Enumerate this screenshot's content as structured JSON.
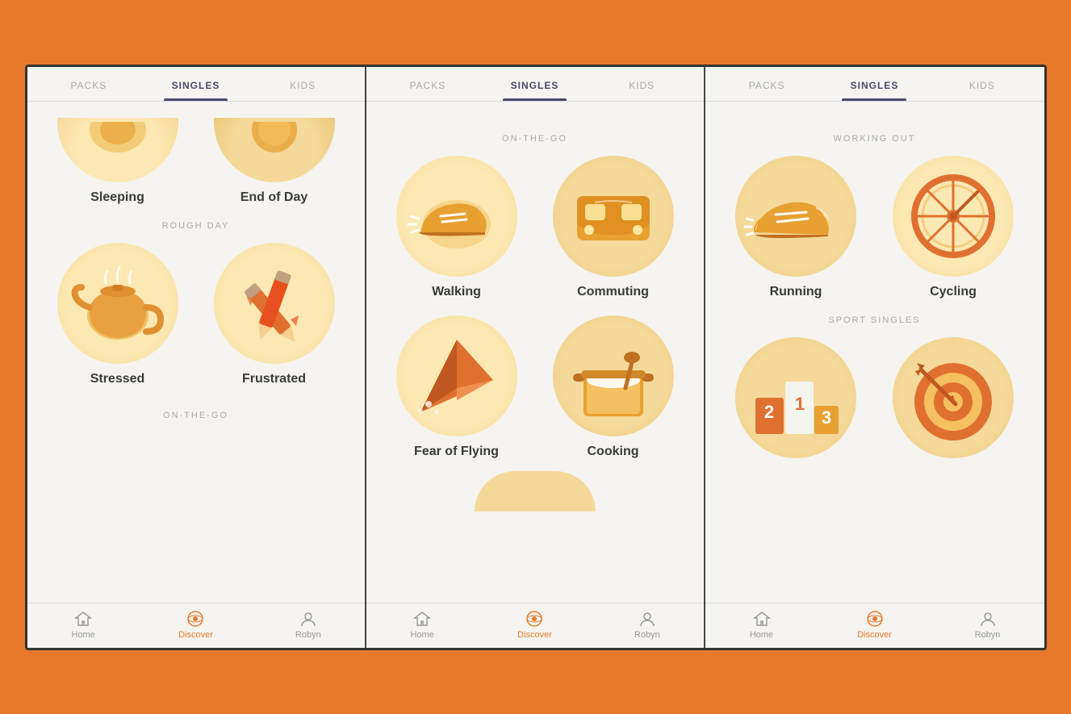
{
  "screens": [
    {
      "id": "screen1",
      "tabs": [
        "PACKS",
        "SINGLES",
        "KIDS"
      ],
      "active_tab": "SINGLES",
      "sections": [
        {
          "label": null,
          "items": [
            {
              "id": "sleeping",
              "name": "Sleeping",
              "partial": true
            },
            {
              "id": "endofday",
              "name": "End of Day",
              "partial": true
            }
          ]
        },
        {
          "label": "ROUGH DAY",
          "items": [
            {
              "id": "stressed",
              "name": "Stressed"
            },
            {
              "id": "frustrated",
              "name": "Frustrated"
            }
          ]
        },
        {
          "label": "ON-THE-GO",
          "items": []
        }
      ],
      "nav": [
        {
          "id": "home",
          "label": "Home",
          "active": false
        },
        {
          "id": "discover",
          "label": "Discover",
          "active": true
        },
        {
          "id": "robyn",
          "label": "Robyn",
          "active": false
        }
      ]
    },
    {
      "id": "screen2",
      "tabs": [
        "PACKS",
        "SINGLES",
        "KIDS"
      ],
      "active_tab": "SINGLES",
      "sections": [
        {
          "label": "ON-THE-GO",
          "items": [
            {
              "id": "walking",
              "name": "Walking"
            },
            {
              "id": "commuting",
              "name": "Commuting"
            },
            {
              "id": "flying",
              "name": "Fear of Flying"
            },
            {
              "id": "cooking",
              "name": "Cooking"
            }
          ]
        }
      ],
      "nav": [
        {
          "id": "home",
          "label": "Home",
          "active": false
        },
        {
          "id": "discover",
          "label": "Discover",
          "active": true
        },
        {
          "id": "robyn",
          "label": "Robyn",
          "active": false
        }
      ]
    },
    {
      "id": "screen3",
      "tabs": [
        "PACKS",
        "SINGLES",
        "KIDS"
      ],
      "active_tab": "SINGLES",
      "sections": [
        {
          "label": "WORKING OUT",
          "items": [
            {
              "id": "running",
              "name": "Running"
            },
            {
              "id": "cycling",
              "name": "Cycling"
            }
          ]
        },
        {
          "label": "SPORT SINGLES",
          "items": [
            {
              "id": "podium",
              "name": ""
            },
            {
              "id": "target",
              "name": ""
            }
          ]
        }
      ],
      "nav": [
        {
          "id": "home",
          "label": "Home",
          "active": false
        },
        {
          "id": "discover",
          "label": "Discover",
          "active": true
        },
        {
          "id": "robyn",
          "label": "Robyn",
          "active": false
        }
      ]
    }
  ],
  "icons": {
    "home": "⌂",
    "discover": "◎",
    "robyn": "👤"
  }
}
